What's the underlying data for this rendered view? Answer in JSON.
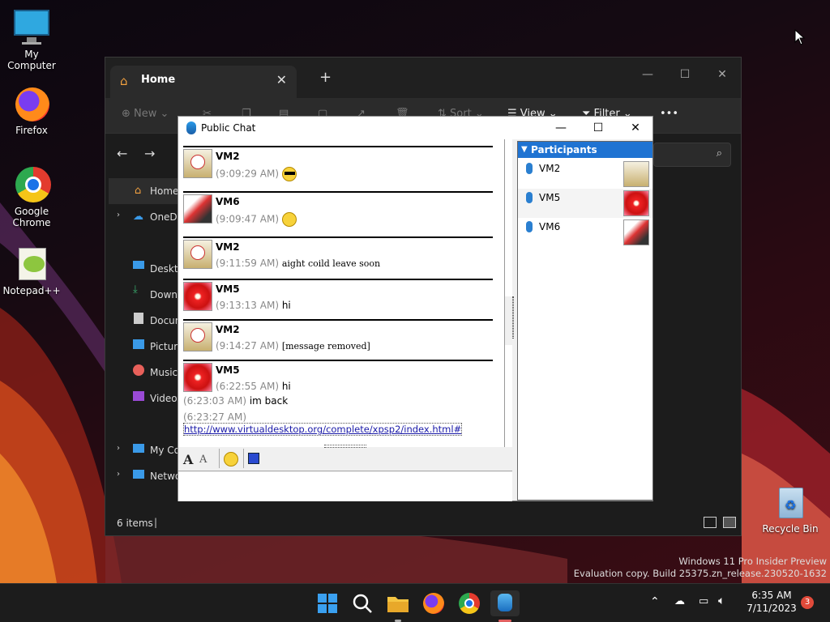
{
  "desktop": {
    "icons": [
      {
        "label": "My Computer"
      },
      {
        "label": "Firefox"
      },
      {
        "label": "Google Chrome"
      },
      {
        "label": "Notepad++"
      },
      {
        "label": "Recycle Bin"
      }
    ],
    "watermark_line1": "Windows 11 Pro Insider Preview",
    "watermark_line2": "Evaluation copy. Build 25375.zn_release.230520-1632"
  },
  "explorer": {
    "tab_title": "Home",
    "new_tab": "+",
    "cmd_new": "New",
    "cmd_sort": "Sort",
    "cmd_view": "View",
    "cmd_filter": "Filter",
    "cmd_more": "•••",
    "sidebar": [
      "Home",
      "OneDr",
      "Deskto",
      "Downl",
      "Docun",
      "Picture",
      "Music",
      "Videos",
      "My Co",
      "Netwo"
    ],
    "status_items": "6 items"
  },
  "chat": {
    "title": "Public Chat",
    "messages": [
      {
        "name": "VM2",
        "time": "(9:09:29 AM)",
        "text": ""
      },
      {
        "name": "VM6",
        "time": "(9:09:47 AM)",
        "text": ""
      },
      {
        "name": "VM2",
        "time": "(9:11:59 AM)",
        "text": "aight coild leave soon"
      },
      {
        "name": "VM5",
        "time": "(9:13:13 AM)",
        "text": "hi"
      },
      {
        "name": "VM2",
        "time": "(9:14:27 AM)",
        "text": "[message removed]"
      },
      {
        "name": "VM5",
        "time": "(6:22:55 AM)",
        "text": "hi"
      }
    ],
    "extra1_time": "(6:23:03 AM)",
    "extra1_text": "im back",
    "extra2_time": "(6:23:27 AM)",
    "link": "http://www.virtualdesktop.org/complete/xpsp2/index.html#",
    "participants_header": "Participants",
    "participants": [
      "VM2",
      "VM5",
      "VM6"
    ]
  },
  "taskbar": {
    "time": "6:35 AM",
    "date": "7/11/2023",
    "notifications": "3"
  }
}
